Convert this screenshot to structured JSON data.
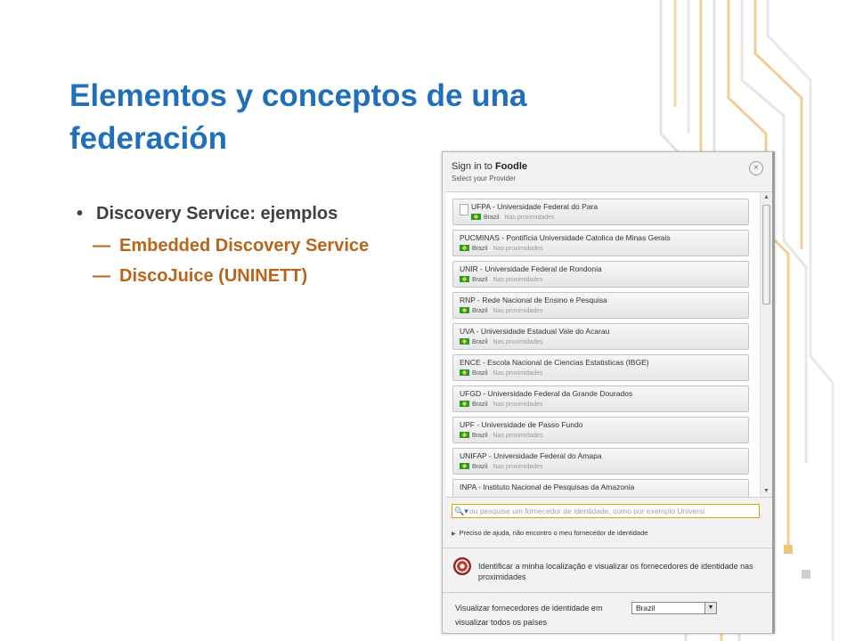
{
  "slide": {
    "title_line1": "Elementos y conceptos de una",
    "title_line2": "federación",
    "bullet_glyph": "•",
    "bullet": "Discovery Service: ejemplos",
    "dash_glyph": "—",
    "subitems": [
      "Embedded Discovery Service",
      "DiscoJuice (UNINETT)"
    ]
  },
  "dialog": {
    "title_prefix": "Sign in to",
    "title_app": "Foodle",
    "subtitle": "Select your Provider",
    "close_glyph": "×",
    "list": [
      {
        "name": "UFPA - Universidade Federal do Para",
        "country": "Brazil",
        "near": "Nas proximidades"
      },
      {
        "name": "PUCMINAS - Pontifícia Universidade Catolica de Minas Gerais",
        "country": "Brazil",
        "near": "Nas proximidades"
      },
      {
        "name": "UNIR - Universidade Federal de Rondonia",
        "country": "Brazil",
        "near": "Nas proximidades"
      },
      {
        "name": "RNP - Rede Nacional de Ensino e Pesquisa",
        "country": "Brazil",
        "near": "Nas proximidades"
      },
      {
        "name": "UVA - Universidade Estadual Vale do Acarau",
        "country": "Brazil",
        "near": "Nas proximidades"
      },
      {
        "name": "ENCE - Escola Nacional de Ciencias Estatisticas (IBGE)",
        "country": "Brazil",
        "near": "Nas proximidades"
      },
      {
        "name": "UFGD - Universidade Federal da Grande Dourados",
        "country": "Brazil",
        "near": "Nas proximidades"
      },
      {
        "name": "UPF - Universidade de Passo Fundo",
        "country": "Brazil",
        "near": "Nas proximidades"
      },
      {
        "name": "UNIFAP - Universidade Federal do Amapa",
        "country": "Brazil",
        "near": "Nas proximidades"
      },
      {
        "name": "INPA - Instituto Nacional de Pesquisas da Amazonia",
        "country": "",
        "near": ""
      }
    ],
    "scroll_up_glyph": "▲",
    "scroll_down_glyph": "▼",
    "search": {
      "icon_glyph": "🔍▾",
      "placeholder": "ou pesquise um fornecedor de identidade, como por exemplo Universi"
    },
    "help": {
      "glyph": "▶",
      "text": "Preciso de ajuda, não encontro o meu fornecedor de identidade"
    },
    "locate_text": "Identificar a minha localização e visualizar os fornecedores de identidade nas proximidades",
    "country_label": "Visualizar fornecedores de identidade em",
    "country_value": "Brazil",
    "dropdown_glyph": "▼",
    "show_all": "visualizar todos os países"
  }
}
